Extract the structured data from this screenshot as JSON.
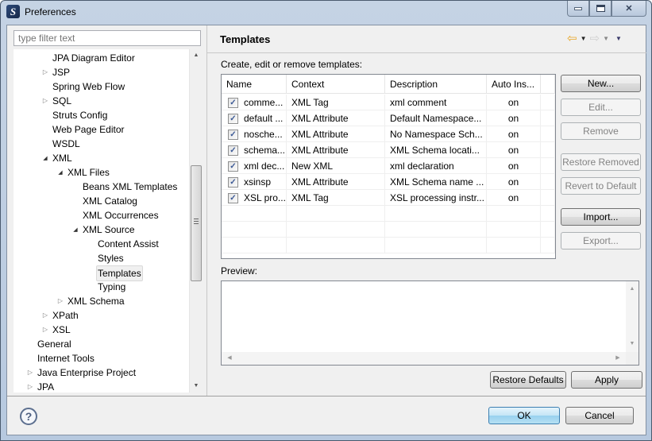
{
  "window": {
    "title": "Preferences",
    "app_icon": "eclipse-app-icon",
    "controls": [
      "minimize",
      "maximize",
      "close"
    ]
  },
  "sidebar": {
    "filter_placeholder": "type filter text",
    "items": [
      {
        "label": "JPA Diagram Editor",
        "level": 2,
        "twisty": "none"
      },
      {
        "label": "JSP",
        "level": 2,
        "twisty": "collapsed"
      },
      {
        "label": "Spring Web Flow",
        "level": 2,
        "twisty": "none"
      },
      {
        "label": "SQL",
        "level": 2,
        "twisty": "collapsed"
      },
      {
        "label": "Struts Config",
        "level": 2,
        "twisty": "none"
      },
      {
        "label": "Web Page Editor",
        "level": 2,
        "twisty": "none"
      },
      {
        "label": "WSDL",
        "level": 2,
        "twisty": "none"
      },
      {
        "label": "XML",
        "level": 2,
        "twisty": "expanded"
      },
      {
        "label": "XML Files",
        "level": 3,
        "twisty": "expanded"
      },
      {
        "label": "Beans XML Templates",
        "level": 4,
        "twisty": "none"
      },
      {
        "label": "XML Catalog",
        "level": 4,
        "twisty": "none"
      },
      {
        "label": "XML Occurrences",
        "level": 4,
        "twisty": "none"
      },
      {
        "label": "XML Source",
        "level": 4,
        "twisty": "expanded"
      },
      {
        "label": "Content Assist",
        "level": 5,
        "twisty": "none"
      },
      {
        "label": "Styles",
        "level": 5,
        "twisty": "none"
      },
      {
        "label": "Templates",
        "level": 5,
        "twisty": "none",
        "selected": true
      },
      {
        "label": "Typing",
        "level": 5,
        "twisty": "none"
      },
      {
        "label": "XML Schema",
        "level": 3,
        "twisty": "collapsed"
      },
      {
        "label": "XPath",
        "level": 2,
        "twisty": "collapsed"
      },
      {
        "label": "XSL",
        "level": 2,
        "twisty": "collapsed"
      },
      {
        "label": "General",
        "level": 1,
        "twisty": "none"
      },
      {
        "label": "Internet Tools",
        "level": 1,
        "twisty": "none"
      },
      {
        "label": "Java Enterprise Project",
        "level": 1,
        "twisty": "collapsed"
      },
      {
        "label": "JPA",
        "level": 1,
        "twisty": "collapsed"
      }
    ]
  },
  "page": {
    "title": "Templates",
    "nav": {
      "back": "back-arrow-icon",
      "forward": "forward-arrow-icon",
      "menu": "view-menu-icon"
    },
    "description": "Create, edit or remove templates:",
    "table": {
      "columns": [
        "Name",
        "Context",
        "Description",
        "Auto Ins..."
      ],
      "rows": [
        {
          "checked": true,
          "name": "comme...",
          "context": "XML Tag",
          "description": "xml comment",
          "auto": "on"
        },
        {
          "checked": true,
          "name": "default ...",
          "context": "XML Attribute",
          "description": "Default Namespace...",
          "auto": "on"
        },
        {
          "checked": true,
          "name": "nosche...",
          "context": "XML Attribute",
          "description": "No Namespace Sch...",
          "auto": "on"
        },
        {
          "checked": true,
          "name": "schema...",
          "context": "XML Attribute",
          "description": "XML Schema locati...",
          "auto": "on"
        },
        {
          "checked": true,
          "name": "xml dec...",
          "context": "New XML",
          "description": "xml declaration",
          "auto": "on"
        },
        {
          "checked": true,
          "name": "xsinsp",
          "context": "XML Attribute",
          "description": "XML Schema name ...",
          "auto": "on"
        },
        {
          "checked": true,
          "name": "XSL pro...",
          "context": "XML Tag",
          "description": "XSL processing instr...",
          "auto": "on"
        }
      ]
    },
    "side_buttons": [
      {
        "label": "New...",
        "enabled": true
      },
      {
        "label": "Edit...",
        "enabled": false
      },
      {
        "label": "Remove",
        "enabled": false
      },
      {
        "label": "Restore Removed",
        "enabled": false
      },
      {
        "label": "Revert to Default",
        "enabled": false
      },
      {
        "label": "Import...",
        "enabled": true
      },
      {
        "label": "Export...",
        "enabled": false
      }
    ],
    "preview_label": "Preview:",
    "preview_text": "",
    "restore_defaults_label": "Restore Defaults",
    "apply_label": "Apply"
  },
  "footer": {
    "help_icon": "help-icon",
    "ok_label": "OK",
    "cancel_label": "Cancel"
  }
}
